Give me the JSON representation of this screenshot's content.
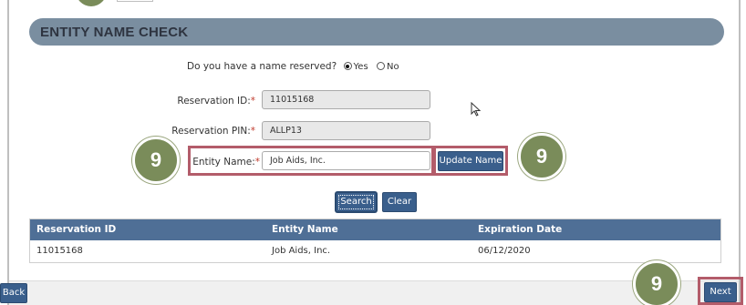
{
  "section": {
    "title": "ENTITY NAME CHECK"
  },
  "question": {
    "text": "Do you have a name reserved?",
    "options": [
      "Yes",
      "No"
    ],
    "selected": "Yes"
  },
  "fields": {
    "reservation_id": {
      "label": "Reservation ID:",
      "required_mark": "*",
      "value": "11015168"
    },
    "reservation_pin": {
      "label": "Reservation PIN:",
      "required_mark": "*",
      "value": "ALLP13"
    },
    "entity_name": {
      "label": "Entity Name:",
      "required_mark": "*",
      "value": "Job Aids, Inc."
    }
  },
  "buttons": {
    "update_name": "Update Name",
    "search": "Search",
    "clear": "Clear",
    "back": "Back",
    "next": "Next"
  },
  "badges": {
    "step": "9"
  },
  "table": {
    "headers": [
      "Reservation ID",
      "Entity Name",
      "Expiration Date"
    ],
    "rows": [
      [
        "11015168",
        "Job Aids, Inc.",
        "06/12/2020"
      ]
    ]
  },
  "colors": {
    "header_band": "#7a8ea0",
    "button": "#3a5f8c",
    "table_header": "#4f6f96",
    "callout": "#b35c6a",
    "badge": "#7a8c5a"
  },
  "icons": {
    "cursor": "mouse-pointer-icon"
  }
}
